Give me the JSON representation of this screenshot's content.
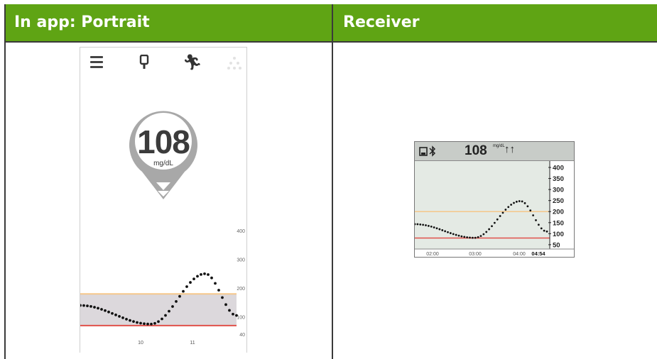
{
  "table": {
    "left_header": "In app: Portrait",
    "right_header": "Receiver"
  },
  "app": {
    "glucose_value": "108",
    "glucose_unit": "mg/dL",
    "icons": [
      "menu-icon",
      "sensor-icon",
      "activity-icon",
      "share-icon",
      "trend-arrow-icon"
    ],
    "y_ticks": [
      "400",
      "300",
      "200",
      "100",
      "40"
    ],
    "x_ticks": [
      "10",
      "11"
    ],
    "colors": {
      "high_line": "#f5c78a",
      "low_line": "#e0504a",
      "target_band": "#dcd8dc",
      "pin": "#a8a8a8"
    }
  },
  "receiver": {
    "glucose_value": "108",
    "glucose_unit": "mg/dL",
    "trend": "↑↑",
    "icons": [
      "battery-icon",
      "bluetooth-icon"
    ],
    "y_ticks": [
      "400",
      "350",
      "300",
      "250",
      "200",
      "150",
      "100",
      "50"
    ],
    "x_ticks": [
      "02:00",
      "03:00",
      "04:00"
    ],
    "current_time": "04:54",
    "colors": {
      "high_line": "#f5c78a",
      "low_line": "#e0504a",
      "background": "#e4eae4"
    }
  }
}
